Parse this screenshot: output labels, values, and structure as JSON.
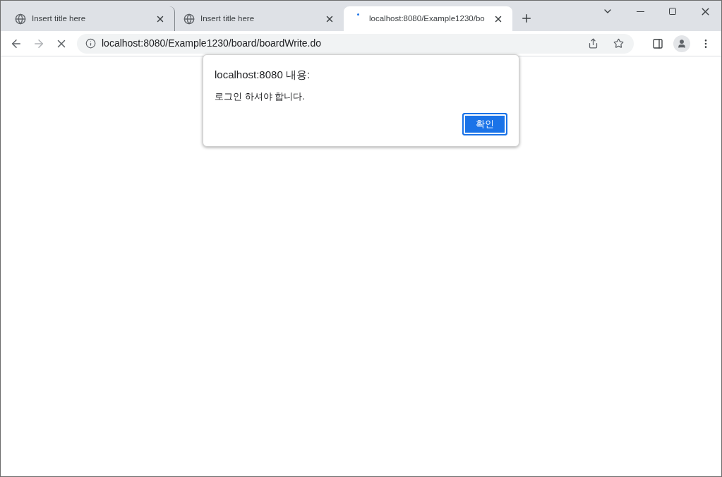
{
  "tabs": [
    {
      "title": "Insert title here",
      "selected": false,
      "loading": false
    },
    {
      "title": "Insert title here",
      "selected": false,
      "loading": false
    },
    {
      "title": "localhost:8080/Example1230/bo",
      "selected": true,
      "loading": true
    }
  ],
  "address_bar": {
    "url": "localhost:8080/Example1230/board/boardWrite.do"
  },
  "dialog": {
    "title": "localhost:8080 내용:",
    "message": "로그인 하셔야 합니다.",
    "button": "확인"
  }
}
